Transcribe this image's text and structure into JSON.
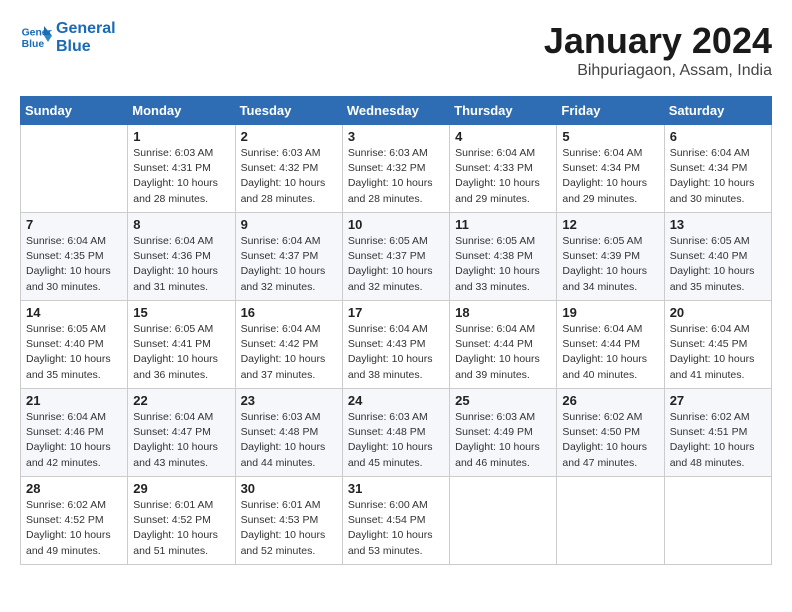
{
  "header": {
    "logo_line1": "General",
    "logo_line2": "Blue",
    "month": "January 2024",
    "location": "Bihpuriagaon, Assam, India"
  },
  "weekdays": [
    "Sunday",
    "Monday",
    "Tuesday",
    "Wednesday",
    "Thursday",
    "Friday",
    "Saturday"
  ],
  "weeks": [
    [
      {
        "day": "",
        "info": ""
      },
      {
        "day": "1",
        "info": "Sunrise: 6:03 AM\nSunset: 4:31 PM\nDaylight: 10 hours\nand 28 minutes."
      },
      {
        "day": "2",
        "info": "Sunrise: 6:03 AM\nSunset: 4:32 PM\nDaylight: 10 hours\nand 28 minutes."
      },
      {
        "day": "3",
        "info": "Sunrise: 6:03 AM\nSunset: 4:32 PM\nDaylight: 10 hours\nand 28 minutes."
      },
      {
        "day": "4",
        "info": "Sunrise: 6:04 AM\nSunset: 4:33 PM\nDaylight: 10 hours\nand 29 minutes."
      },
      {
        "day": "5",
        "info": "Sunrise: 6:04 AM\nSunset: 4:34 PM\nDaylight: 10 hours\nand 29 minutes."
      },
      {
        "day": "6",
        "info": "Sunrise: 6:04 AM\nSunset: 4:34 PM\nDaylight: 10 hours\nand 30 minutes."
      }
    ],
    [
      {
        "day": "7",
        "info": "Sunrise: 6:04 AM\nSunset: 4:35 PM\nDaylight: 10 hours\nand 30 minutes."
      },
      {
        "day": "8",
        "info": "Sunrise: 6:04 AM\nSunset: 4:36 PM\nDaylight: 10 hours\nand 31 minutes."
      },
      {
        "day": "9",
        "info": "Sunrise: 6:04 AM\nSunset: 4:37 PM\nDaylight: 10 hours\nand 32 minutes."
      },
      {
        "day": "10",
        "info": "Sunrise: 6:05 AM\nSunset: 4:37 PM\nDaylight: 10 hours\nand 32 minutes."
      },
      {
        "day": "11",
        "info": "Sunrise: 6:05 AM\nSunset: 4:38 PM\nDaylight: 10 hours\nand 33 minutes."
      },
      {
        "day": "12",
        "info": "Sunrise: 6:05 AM\nSunset: 4:39 PM\nDaylight: 10 hours\nand 34 minutes."
      },
      {
        "day": "13",
        "info": "Sunrise: 6:05 AM\nSunset: 4:40 PM\nDaylight: 10 hours\nand 35 minutes."
      }
    ],
    [
      {
        "day": "14",
        "info": "Sunrise: 6:05 AM\nSunset: 4:40 PM\nDaylight: 10 hours\nand 35 minutes."
      },
      {
        "day": "15",
        "info": "Sunrise: 6:05 AM\nSunset: 4:41 PM\nDaylight: 10 hours\nand 36 minutes."
      },
      {
        "day": "16",
        "info": "Sunrise: 6:04 AM\nSunset: 4:42 PM\nDaylight: 10 hours\nand 37 minutes."
      },
      {
        "day": "17",
        "info": "Sunrise: 6:04 AM\nSunset: 4:43 PM\nDaylight: 10 hours\nand 38 minutes."
      },
      {
        "day": "18",
        "info": "Sunrise: 6:04 AM\nSunset: 4:44 PM\nDaylight: 10 hours\nand 39 minutes."
      },
      {
        "day": "19",
        "info": "Sunrise: 6:04 AM\nSunset: 4:44 PM\nDaylight: 10 hours\nand 40 minutes."
      },
      {
        "day": "20",
        "info": "Sunrise: 6:04 AM\nSunset: 4:45 PM\nDaylight: 10 hours\nand 41 minutes."
      }
    ],
    [
      {
        "day": "21",
        "info": "Sunrise: 6:04 AM\nSunset: 4:46 PM\nDaylight: 10 hours\nand 42 minutes."
      },
      {
        "day": "22",
        "info": "Sunrise: 6:04 AM\nSunset: 4:47 PM\nDaylight: 10 hours\nand 43 minutes."
      },
      {
        "day": "23",
        "info": "Sunrise: 6:03 AM\nSunset: 4:48 PM\nDaylight: 10 hours\nand 44 minutes."
      },
      {
        "day": "24",
        "info": "Sunrise: 6:03 AM\nSunset: 4:48 PM\nDaylight: 10 hours\nand 45 minutes."
      },
      {
        "day": "25",
        "info": "Sunrise: 6:03 AM\nSunset: 4:49 PM\nDaylight: 10 hours\nand 46 minutes."
      },
      {
        "day": "26",
        "info": "Sunrise: 6:02 AM\nSunset: 4:50 PM\nDaylight: 10 hours\nand 47 minutes."
      },
      {
        "day": "27",
        "info": "Sunrise: 6:02 AM\nSunset: 4:51 PM\nDaylight: 10 hours\nand 48 minutes."
      }
    ],
    [
      {
        "day": "28",
        "info": "Sunrise: 6:02 AM\nSunset: 4:52 PM\nDaylight: 10 hours\nand 49 minutes."
      },
      {
        "day": "29",
        "info": "Sunrise: 6:01 AM\nSunset: 4:52 PM\nDaylight: 10 hours\nand 51 minutes."
      },
      {
        "day": "30",
        "info": "Sunrise: 6:01 AM\nSunset: 4:53 PM\nDaylight: 10 hours\nand 52 minutes."
      },
      {
        "day": "31",
        "info": "Sunrise: 6:00 AM\nSunset: 4:54 PM\nDaylight: 10 hours\nand 53 minutes."
      },
      {
        "day": "",
        "info": ""
      },
      {
        "day": "",
        "info": ""
      },
      {
        "day": "",
        "info": ""
      }
    ]
  ]
}
